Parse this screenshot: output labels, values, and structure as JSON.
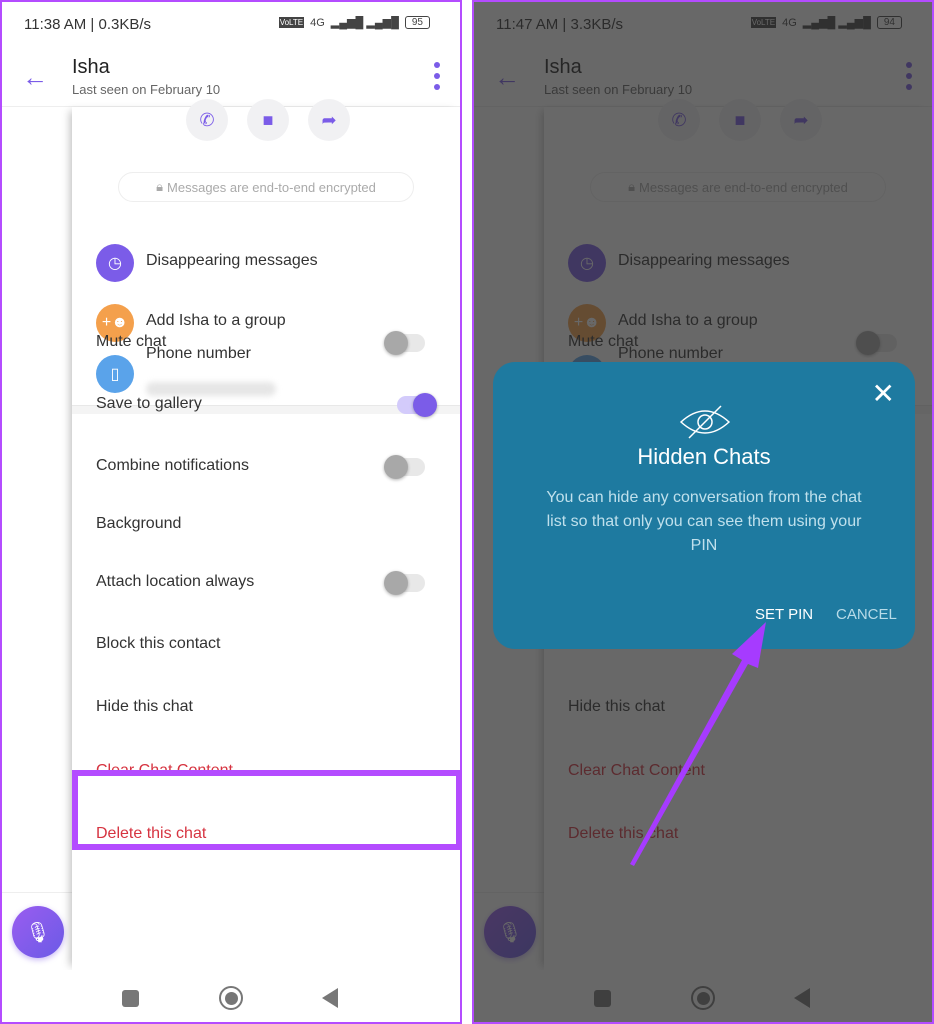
{
  "panels": [
    {
      "status_time": "11:38 AM | 0.3KB/s",
      "battery": "95"
    },
    {
      "status_time": "11:47 AM | 3.3KB/s",
      "battery": "94"
    }
  ],
  "status_icons": {
    "network": "4G",
    "volte": "VoLTE"
  },
  "header": {
    "title": "Isha",
    "subtitle": "Last seen on February 10"
  },
  "actions": [
    "phone-icon",
    "video-icon",
    "share-contact-icon"
  ],
  "encryption_note": "Messages are end-to-end encrypted",
  "info_items": [
    {
      "label": "Disappearing messages",
      "icon": "timer-icon",
      "color": "#7b5ce8"
    },
    {
      "label": "Add Isha to a group",
      "icon": "add-group-icon",
      "color": "#f4a04c"
    },
    {
      "label": "Phone number",
      "icon": "phone-device-icon",
      "color": "#5aa3ea"
    }
  ],
  "settings": [
    {
      "label": "Mute chat",
      "toggle": false
    },
    {
      "label": "Save to gallery",
      "toggle": true
    },
    {
      "label": "Combine notifications",
      "toggle": false
    },
    {
      "label": "Background"
    },
    {
      "label": "Attach location always",
      "toggle": false
    },
    {
      "label": "Block this contact"
    },
    {
      "label": "Hide this chat",
      "highlighted": true
    },
    {
      "label": "Clear Chat Content",
      "danger": true
    },
    {
      "label": "Delete this chat",
      "danger": true
    }
  ],
  "dialog": {
    "title": "Hidden Chats",
    "body": "You can hide any conversation from the chat list so that only you can see them using your PIN",
    "set_pin": "SET PIN",
    "cancel": "CANCEL"
  },
  "colors": {
    "accent": "#7b5ce8",
    "danger": "#d63340",
    "highlight": "#b44cff",
    "dialog": "#1e7aa0"
  }
}
